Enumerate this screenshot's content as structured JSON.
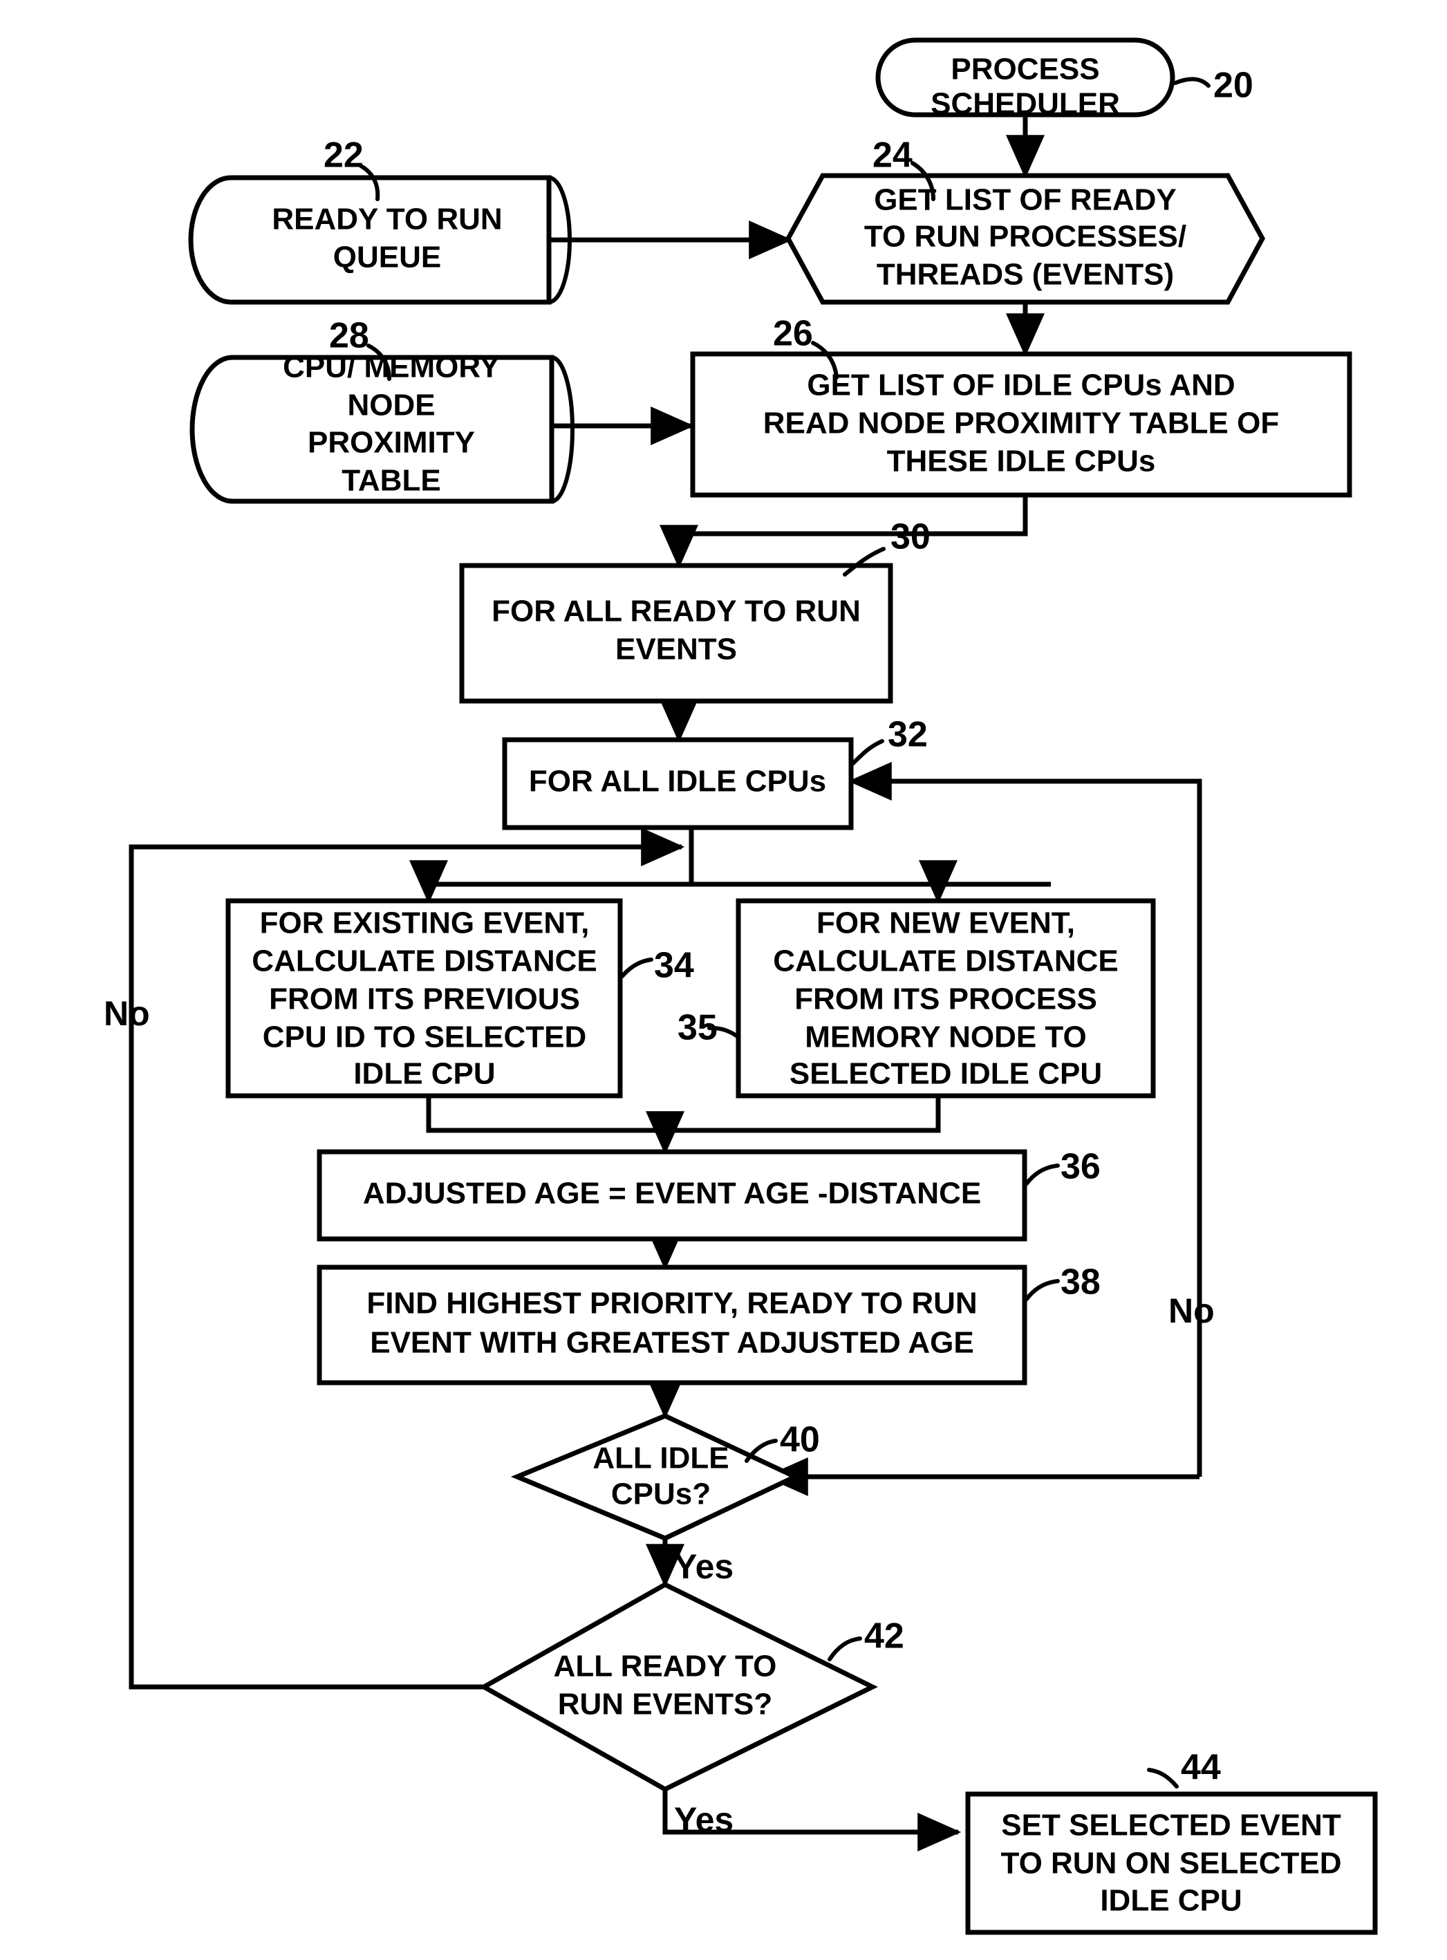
{
  "figure": {
    "type": "patent-flowchart",
    "title": "Process scheduler flowchart",
    "background_color": "#ffffff",
    "line_color": "#000000"
  },
  "nodes": {
    "n20": {
      "ref": "20",
      "shape": "rounded-terminator",
      "lines": [
        "PROCESS",
        "SCHEDULER"
      ]
    },
    "n22": {
      "ref": "22",
      "shape": "cylinder",
      "lines": [
        "READY TO RUN",
        "QUEUE"
      ]
    },
    "n24": {
      "ref": "24",
      "shape": "hexagon",
      "lines": [
        "GET LIST OF READY",
        "TO RUN PROCESSES/",
        "THREADS (EVENTS)"
      ]
    },
    "n26": {
      "ref": "26",
      "shape": "rectangle",
      "lines": [
        "GET LIST OF IDLE CPUs AND",
        "READ NODE PROXIMITY TABLE OF",
        "THESE IDLE CPUs"
      ]
    },
    "n28": {
      "ref": "28",
      "shape": "cylinder",
      "lines": [
        "CPU/ MEMORY",
        "NODE",
        "PROXIMITY",
        "TABLE"
      ]
    },
    "n30": {
      "ref": "30",
      "shape": "rectangle",
      "lines": [
        "FOR ALL READY TO RUN",
        "EVENTS"
      ]
    },
    "n32": {
      "ref": "32",
      "shape": "rectangle",
      "lines": [
        "FOR ALL IDLE CPUs"
      ]
    },
    "n34": {
      "ref": "34",
      "shape": "rectangle",
      "lines": [
        "FOR EXISTING EVENT,",
        "CALCULATE DISTANCE",
        "FROM ITS PREVIOUS",
        "CPU ID TO SELECTED",
        "IDLE CPU"
      ]
    },
    "n35": {
      "ref": "35",
      "shape": "rectangle",
      "lines": [
        "FOR NEW EVENT,",
        "CALCULATE DISTANCE",
        "FROM ITS PROCESS",
        "MEMORY NODE TO",
        "SELECTED IDLE CPU"
      ]
    },
    "n36": {
      "ref": "36",
      "shape": "rectangle",
      "lines": [
        "ADJUSTED AGE = EVENT AGE -DISTANCE"
      ]
    },
    "n38": {
      "ref": "38",
      "shape": "rectangle",
      "lines": [
        "FIND HIGHEST PRIORITY, READY TO RUN",
        "EVENT WITH GREATEST ADJUSTED AGE"
      ]
    },
    "n40": {
      "ref": "40",
      "shape": "diamond",
      "lines": [
        "ALL IDLE",
        "CPUs?"
      ]
    },
    "n42": {
      "ref": "42",
      "shape": "diamond",
      "lines": [
        "ALL READY TO",
        "RUN EVENTS?"
      ]
    },
    "n44": {
      "ref": "44",
      "shape": "rectangle",
      "lines": [
        "SET SELECTED EVENT",
        "TO RUN ON SELECTED",
        "IDLE CPU"
      ]
    }
  },
  "edge_labels": {
    "no_right_40": "No",
    "yes_40": "Yes",
    "no_left_42": "No",
    "yes_42": "Yes"
  }
}
